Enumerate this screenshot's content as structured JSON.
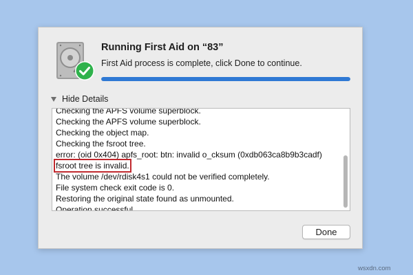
{
  "dialog": {
    "title": "Running First Aid on “83”",
    "subtitle": "First Aid process is complete, click Done to continue.",
    "progress": 1.0,
    "details_toggle_label": "Hide Details",
    "done_label": "Done"
  },
  "log": {
    "lines": [
      "Checking the APFS volume superblock.",
      "Checking the APFS volume superblock.",
      "Checking the object map.",
      "Checking the fsroot tree.",
      "error: (oid 0x404) apfs_root: btn: invalid o_cksum (0xdb063ca8b9b3cadf)",
      "fsroot tree is invalid.",
      "The volume /dev/rdisk4s1 could not be verified completely.",
      "File system check exit code is 0.",
      "Restoring the original state found as unmounted.",
      "Operation successful."
    ],
    "highlighted_line_index": 5
  },
  "icons": {
    "disk": "hard-disk-icon",
    "check": "green-checkmark-icon",
    "toggle": "disclosure-triangle-down-icon"
  },
  "colors": {
    "background": "#a7c6ec",
    "progress": "#2f79d4",
    "highlight_border": "#c0282d",
    "check_green": "#2fb24c"
  },
  "watermark": "wsxdn.com"
}
